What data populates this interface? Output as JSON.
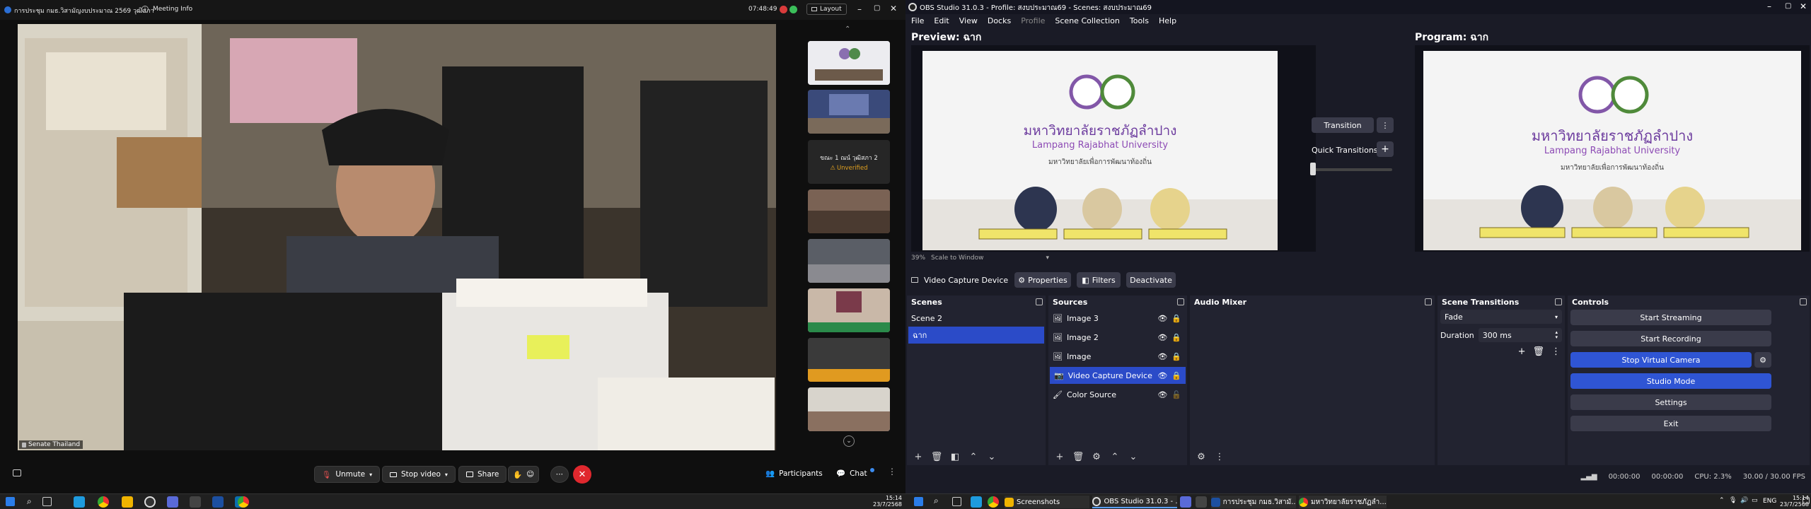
{
  "meeting": {
    "title": "การประชุม กมธ.วิสามัญงบประมาณ 2569 วุฒิสภา",
    "info_label": "Meeting Info",
    "time": "07:48:49",
    "layout_label": "Layout",
    "participant_name": "Senate Thailand",
    "side_panel_label": "ขณะ 1 ณน์ วุฒิสภา 2",
    "unverified_label": "Unverified",
    "controls": {
      "unmute": "Unmute",
      "stop_video": "Stop video",
      "share": "Share",
      "participants": "Participants",
      "chat": "Chat"
    }
  },
  "taskbar_left": {
    "time": "15:14",
    "date": "23/7/2568"
  },
  "obs": {
    "title": "OBS Studio 31.0.3 - Profile: สงบประมาณ69 - Scenes: สงบประมาณ69",
    "menu": [
      "File",
      "Edit",
      "View",
      "Docks",
      "Profile",
      "Scene Collection",
      "Tools",
      "Help"
    ],
    "preview_label": "Preview: ฉาก",
    "program_label": "Program: ฉาก",
    "zoom": "39%",
    "scale_label": "Scale to Window",
    "transition_button": "Transition",
    "quick_transitions": "Quick Transitions",
    "projector": {
      "university_thai": "มหาวิทยาลัยราชภัฏลำปาง",
      "university_en": "Lampang Rajabhat University",
      "tagline": "มหาวิทยาลัยเพื่อการพัฒนาท้องถิ่น"
    },
    "source_toolbar": {
      "source_name": "Video Capture Device",
      "properties": "Properties",
      "filters": "Filters",
      "deactivate": "Deactivate"
    },
    "docks": {
      "scenes_title": "Scenes",
      "sources_title": "Sources",
      "audio_title": "Audio Mixer",
      "transitions_title": "Scene Transitions",
      "controls_title": "Controls"
    },
    "scenes": [
      "Scene 2",
      "ฉาก"
    ],
    "selected_scene": 1,
    "sources": [
      "Image 3",
      "Image 2",
      "Image",
      "Video Capture Device",
      "Color Source"
    ],
    "selected_source": 3,
    "transition": {
      "type": "Fade",
      "duration_label": "Duration",
      "duration_value": "300 ms"
    },
    "controls": {
      "start_streaming": "Start Streaming",
      "start_recording": "Start Recording",
      "stop_virtual_camera": "Stop Virtual Camera",
      "studio_mode": "Studio Mode",
      "settings": "Settings",
      "exit": "Exit"
    },
    "status": {
      "stream_time": "00:00:00",
      "record_time": "00:00:00",
      "cpu": "CPU: 2.3%",
      "fps": "30.00 / 30.00 FPS"
    }
  },
  "taskbar_right": {
    "items": [
      "Screenshots",
      "OBS Studio 31.0.3 - ...",
      "การประชุม กมธ.วิสามั...",
      "มหาวิทยาลัยราชภัฏลำ..."
    ],
    "lang": "ENG",
    "time": "15:14",
    "date": "23/7/2568"
  }
}
